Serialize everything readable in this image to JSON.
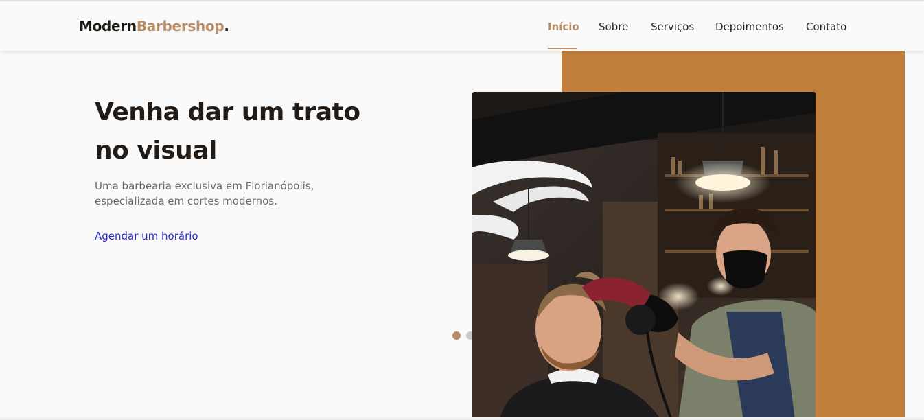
{
  "brand": {
    "part1": "Modern",
    "part2": "Barbershop",
    "dot": "."
  },
  "nav": {
    "items": [
      {
        "label": "Início",
        "active": true
      },
      {
        "label": "Sobre",
        "active": false
      },
      {
        "label": "Serviços",
        "active": false
      },
      {
        "label": "Depoimentos",
        "active": false
      },
      {
        "label": "Contato",
        "active": false
      }
    ]
  },
  "hero": {
    "title_line1": "Venha dar um trato",
    "title_line2": "no visual",
    "subtitle_line1": "Uma barbearia exclusiva em Florianópolis,",
    "subtitle_line2": "especializada em cortes modernos.",
    "cta_label": "Agendar um horário",
    "image_alt": "barber-drying-client-hair-photo"
  },
  "carousel": {
    "total": 2,
    "active": 1
  },
  "colors": {
    "accent": "#b88d66",
    "panel": "#c17f3e",
    "title": "#231b15",
    "link": "#2b2bd6",
    "background": "#fafafa"
  }
}
